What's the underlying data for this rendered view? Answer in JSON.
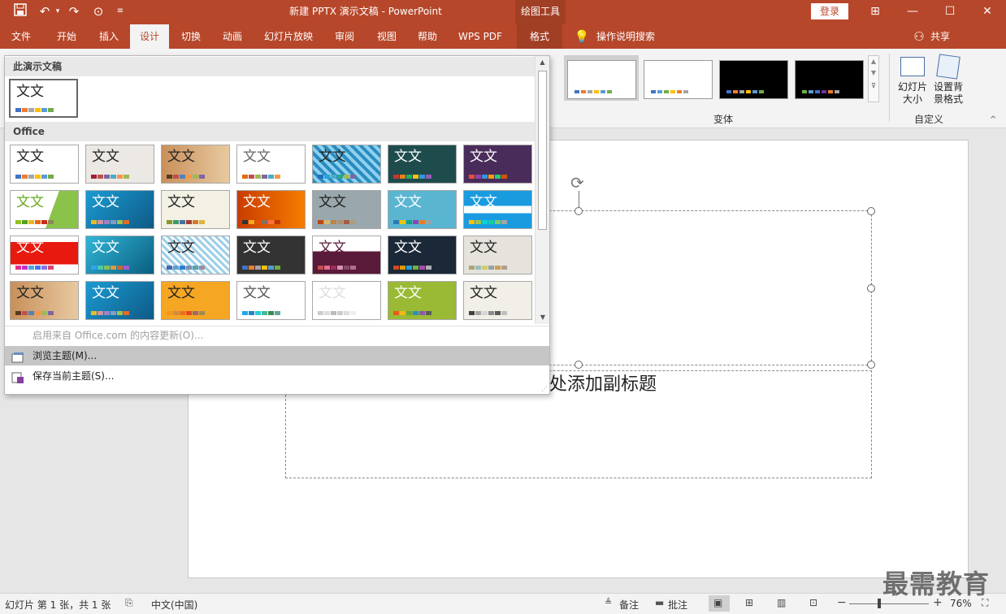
{
  "titlebar": {
    "doc_title": "新建 PPTX 演示文稿  -  PowerPoint",
    "context_group": "绘图工具",
    "login": "登录",
    "qat_icons": [
      "save-icon",
      "undo-icon",
      "redo-icon",
      "presenter-icon",
      "customize-icon"
    ]
  },
  "tabs": [
    "文件",
    "开始",
    "插入",
    "设计",
    "切换",
    "动画",
    "幻灯片放映",
    "审阅",
    "视图",
    "帮助",
    "WPS PDF",
    "格式"
  ],
  "active_tab": "设计",
  "tell_me": "操作说明搜索",
  "share": "共享",
  "ribbon": {
    "variants_label": "变体",
    "customize_label": "自定义",
    "slide_size": "幻灯片\n大小",
    "format_bg": "设置背\n景格式"
  },
  "gallery": {
    "this_pres_header": "此演示文稿",
    "office_header": "Office",
    "thumb_text": "文文",
    "menu": {
      "office_update": "启用来自 Office.com 的内容更新(O)...",
      "browse": "浏览主题(M)...",
      "save": "保存当前主题(S)..."
    }
  },
  "slide": {
    "subtitle": "处添加副标题"
  },
  "status": {
    "slide_info": "幻灯片 第 1 张，共 1 张",
    "language": "中文(中国)",
    "notes": "备注",
    "comments": "批注",
    "zoom": "76%"
  },
  "watermark": "最需教育",
  "colors": {
    "accent": "#b7472a",
    "ribbon_bg": "#f3f3f3",
    "hover": "#c6c6c6"
  }
}
